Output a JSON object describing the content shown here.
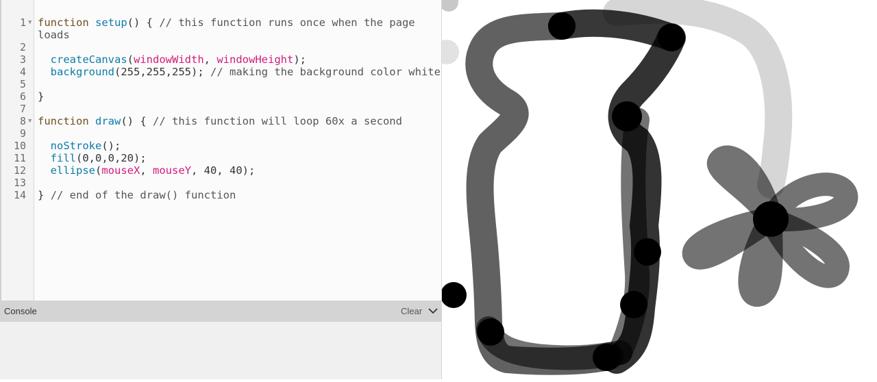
{
  "editor": {
    "line_numbers": [
      "1",
      "2",
      "3",
      "4",
      "5",
      "6",
      "7",
      "8",
      "9",
      "10",
      "11",
      "12",
      "13",
      "14"
    ],
    "code": {
      "l1_kw": "function",
      "l1_fn": "setup",
      "l1_punc": "() {",
      "l1_comment": "// this function runs once when the page",
      "l1_wrap": "loads",
      "l3_fn": "createCanvas",
      "l3_open": "(",
      "l3_var1": "windowWidth",
      "l3_sep": ", ",
      "l3_var2": "windowHeight",
      "l3_close": ");",
      "l4_fn": "background",
      "l4_args": "(255,255,255);",
      "l4_comment": "// making the background color white",
      "l6": "}",
      "l8_kw": "function",
      "l8_fn": "draw",
      "l8_punc": "() {",
      "l8_comment": "// this function will loop 60x a second",
      "l10_fn": "noStroke",
      "l10_rest": "();",
      "l11_fn": "fill",
      "l11_rest": "(0,0,0,20);",
      "l12_fn": "ellipse",
      "l12_open": "(",
      "l12_var1": "mouseX",
      "l12_sep": ", ",
      "l12_var2": "mouseY",
      "l12_rest": ", 40, 40);",
      "l14_brace": "}",
      "l14_comment": "// end of the draw() function"
    }
  },
  "console": {
    "title": "Console",
    "clear_label": "Clear"
  },
  "canvas": {
    "background": "#ffffff",
    "brush_color": "#000000"
  }
}
